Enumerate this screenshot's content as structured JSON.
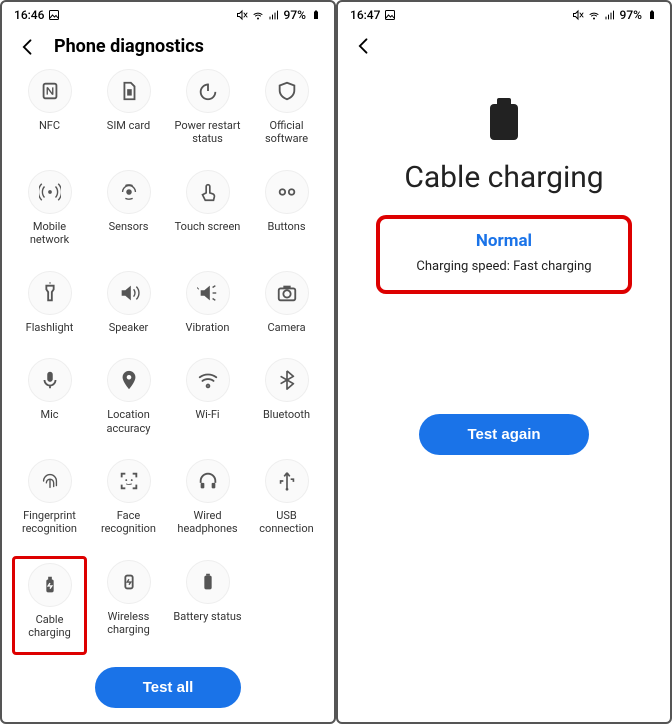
{
  "left": {
    "status": {
      "time": "16:46",
      "battery": "97%"
    },
    "title": "Phone diagnostics",
    "items": [
      {
        "label": "NFC",
        "icon": "nfc-icon"
      },
      {
        "label": "SIM card",
        "icon": "sim-icon"
      },
      {
        "label": "Power restart status",
        "icon": "power-icon"
      },
      {
        "label": "Official software",
        "icon": "shield-icon"
      },
      {
        "label": "Mobile network",
        "icon": "antenna-icon"
      },
      {
        "label": "Sensors",
        "icon": "sensors-icon"
      },
      {
        "label": "Touch screen",
        "icon": "touch-icon"
      },
      {
        "label": "Buttons",
        "icon": "buttons-icon"
      },
      {
        "label": "Flashlight",
        "icon": "flashlight-icon"
      },
      {
        "label": "Speaker",
        "icon": "speaker-icon"
      },
      {
        "label": "Vibration",
        "icon": "vibration-icon"
      },
      {
        "label": "Camera",
        "icon": "camera-icon"
      },
      {
        "label": "Mic",
        "icon": "mic-icon"
      },
      {
        "label": "Location accuracy",
        "icon": "location-icon"
      },
      {
        "label": "Wi-Fi",
        "icon": "wifi-icon"
      },
      {
        "label": "Bluetooth",
        "icon": "bluetooth-icon"
      },
      {
        "label": "Fingerprint recognition",
        "icon": "fingerprint-icon"
      },
      {
        "label": "Face recognition",
        "icon": "face-icon"
      },
      {
        "label": "Wired headphones",
        "icon": "headphones-icon"
      },
      {
        "label": "USB connection",
        "icon": "usb-icon"
      },
      {
        "label": "Cable charging",
        "icon": "cable-charging-icon",
        "highlight": true
      },
      {
        "label": "Wireless charging",
        "icon": "wireless-charging-icon"
      },
      {
        "label": "Battery status",
        "icon": "battery-icon"
      }
    ],
    "test_all": "Test all"
  },
  "right": {
    "status": {
      "time": "16:47",
      "battery": "97%"
    },
    "title": "Cable charging",
    "result_status": "Normal",
    "result_detail": "Charging speed: Fast charging",
    "test_again": "Test again"
  }
}
